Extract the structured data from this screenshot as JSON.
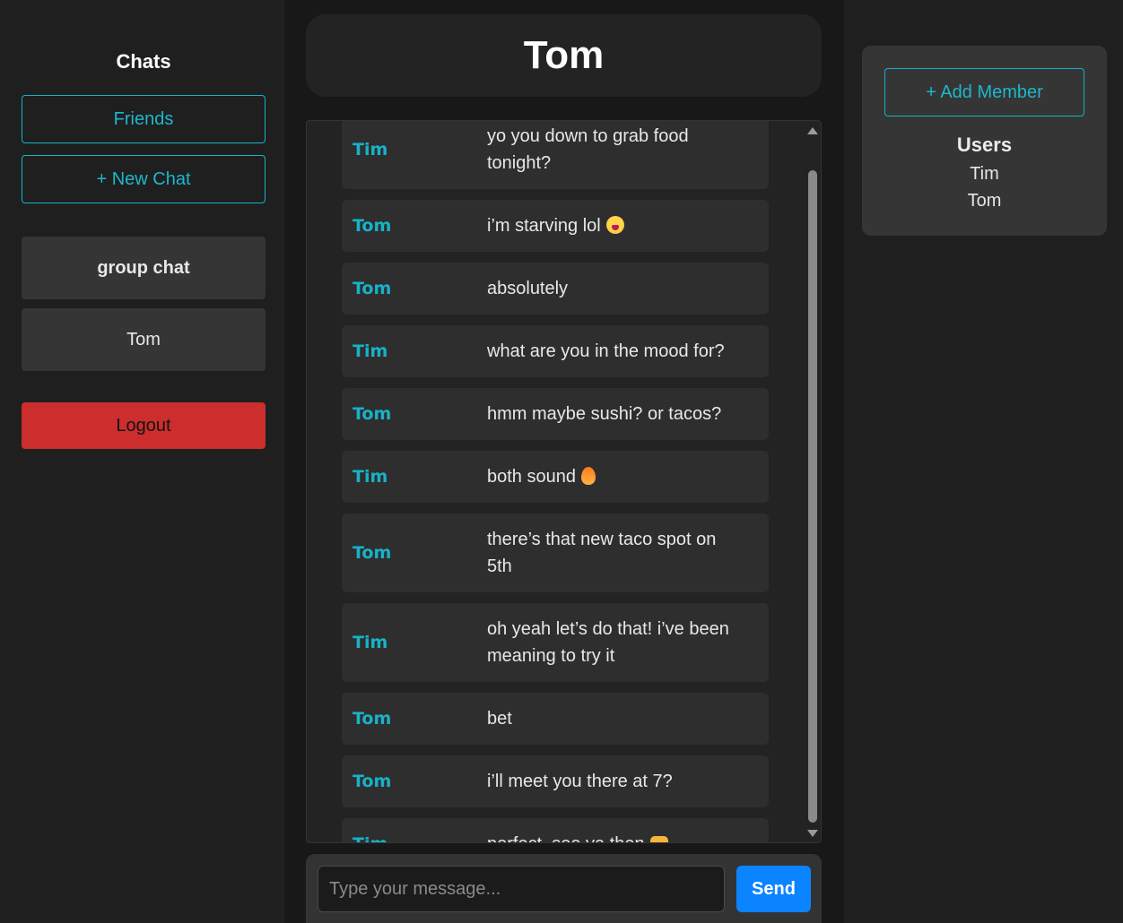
{
  "sidebar": {
    "title": "Chats",
    "friends_label": "Friends",
    "new_chat_label": "+ New Chat",
    "chats": [
      {
        "label": "group chat"
      },
      {
        "label": "Tom"
      }
    ],
    "logout_label": "Logout"
  },
  "chat": {
    "title": "Tom",
    "messages": [
      {
        "sender": "Tim",
        "text": "yo you down to grab food tonight?"
      },
      {
        "sender": "Tom",
        "text": "i’m starving lol",
        "emoji": "weary-face-icon"
      },
      {
        "sender": "Tom",
        "text": "absolutely"
      },
      {
        "sender": "Tim",
        "text": "what are you in the mood for?"
      },
      {
        "sender": "Tom",
        "text": "hmm maybe sushi? or tacos?"
      },
      {
        "sender": "Tim",
        "text": "both sound",
        "emoji": "fire-icon"
      },
      {
        "sender": "Tom",
        "text": "there’s that new taco spot on 5th"
      },
      {
        "sender": "Tim",
        "text": "oh yeah let’s do that! i’ve been meaning to try it"
      },
      {
        "sender": "Tom",
        "text": "bet"
      },
      {
        "sender": "Tom",
        "text": "i’ll meet you there at 7?"
      },
      {
        "sender": "Tim",
        "text": "perfect. see ya then",
        "emoji": "fist-bump-icon"
      }
    ],
    "input_placeholder": "Type your message...",
    "input_value": "",
    "send_label": "Send"
  },
  "members": {
    "add_member_label": "+ Add Member",
    "users_title": "Users",
    "users": [
      "Tim",
      "Tom"
    ]
  },
  "colors": {
    "accent": "#14b3c7",
    "logout": "#cc2d2d",
    "send": "#0a84ff"
  }
}
